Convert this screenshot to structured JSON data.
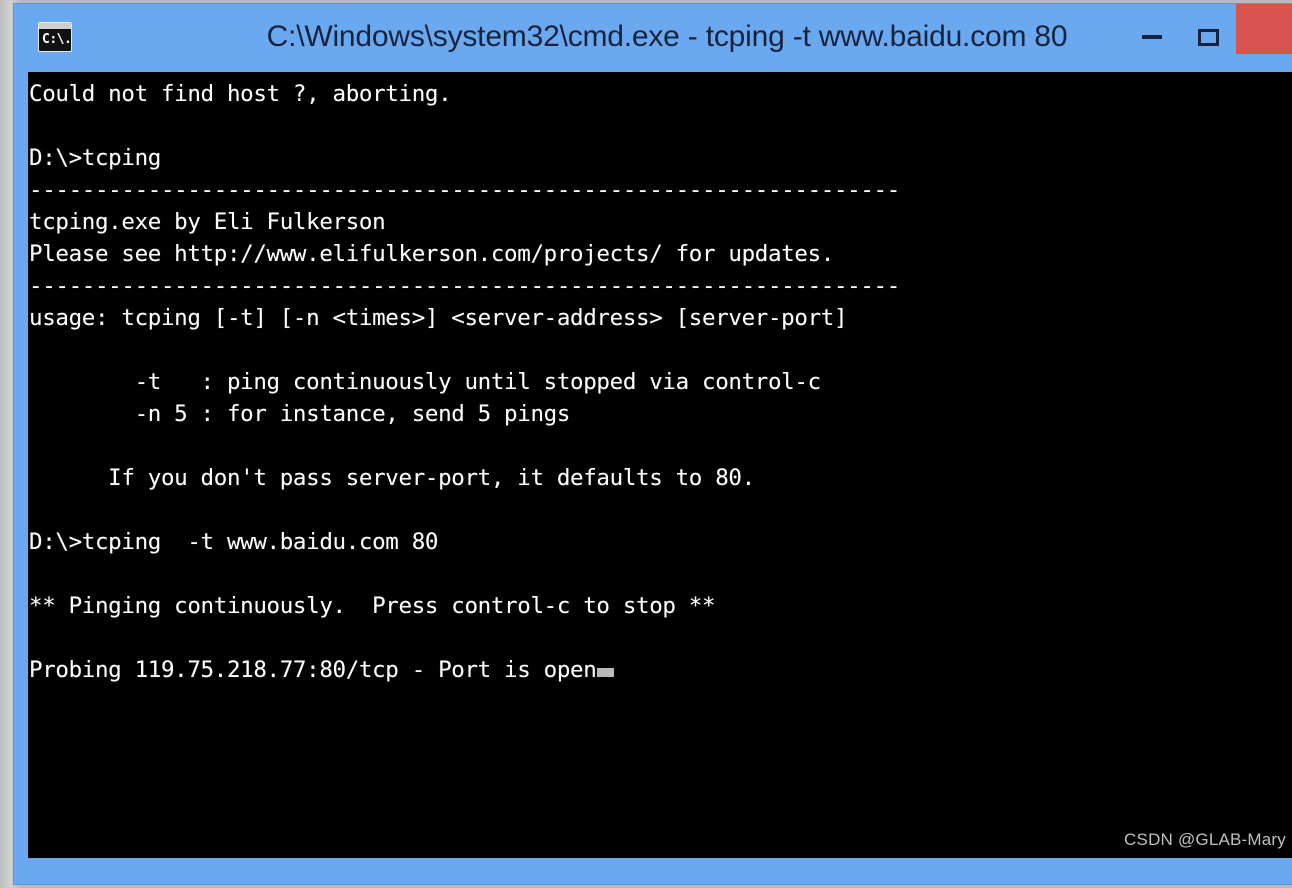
{
  "window": {
    "title": "C:\\Windows\\system32\\cmd.exe - tcping  -t www.baidu.com 80",
    "icon_name": "cmd-console-icon",
    "icon_glyph": "C:\\.",
    "titlebar_color": "#6aa8f0",
    "title_text_color": "#16233f",
    "close_button_color": "#d9534f",
    "console_background": "#000000",
    "console_foreground": "#ffffff"
  },
  "controls": {
    "minimize_label": "–",
    "maximize_label": "❐",
    "close_label": ""
  },
  "console": {
    "lines": [
      "Could not find host ?, aborting.",
      "",
      "D:\\>tcping",
      "------------------------------------------------------------------",
      "tcping.exe by Eli Fulkerson",
      "Please see http://www.elifulkerson.com/projects/ for updates.",
      "------------------------------------------------------------------",
      "usage: tcping [-t] [-n <times>] <server-address> [server-port]",
      "",
      "        -t   : ping continuously until stopped via control-c",
      "        -n 5 : for instance, send 5 pings",
      "",
      "      If you don't pass server-port, it defaults to 80.",
      "",
      "D:\\>tcping  -t www.baidu.com 80",
      "",
      "** Pinging continuously.  Press control-c to stop **",
      "",
      "Probing 119.75.218.77:80/tcp - Port is open"
    ],
    "cursor_visible": true,
    "cursor_color": "#b9b9b9",
    "prompt": "D:\\>",
    "command_typed": "tcping  -t www.baidu.com 80",
    "target_host": "www.baidu.com",
    "target_port": "80",
    "resolved_ip": "119.75.218.77",
    "status": "Port is open"
  },
  "watermark": {
    "text": "CSDN @GLAB-Mary"
  }
}
